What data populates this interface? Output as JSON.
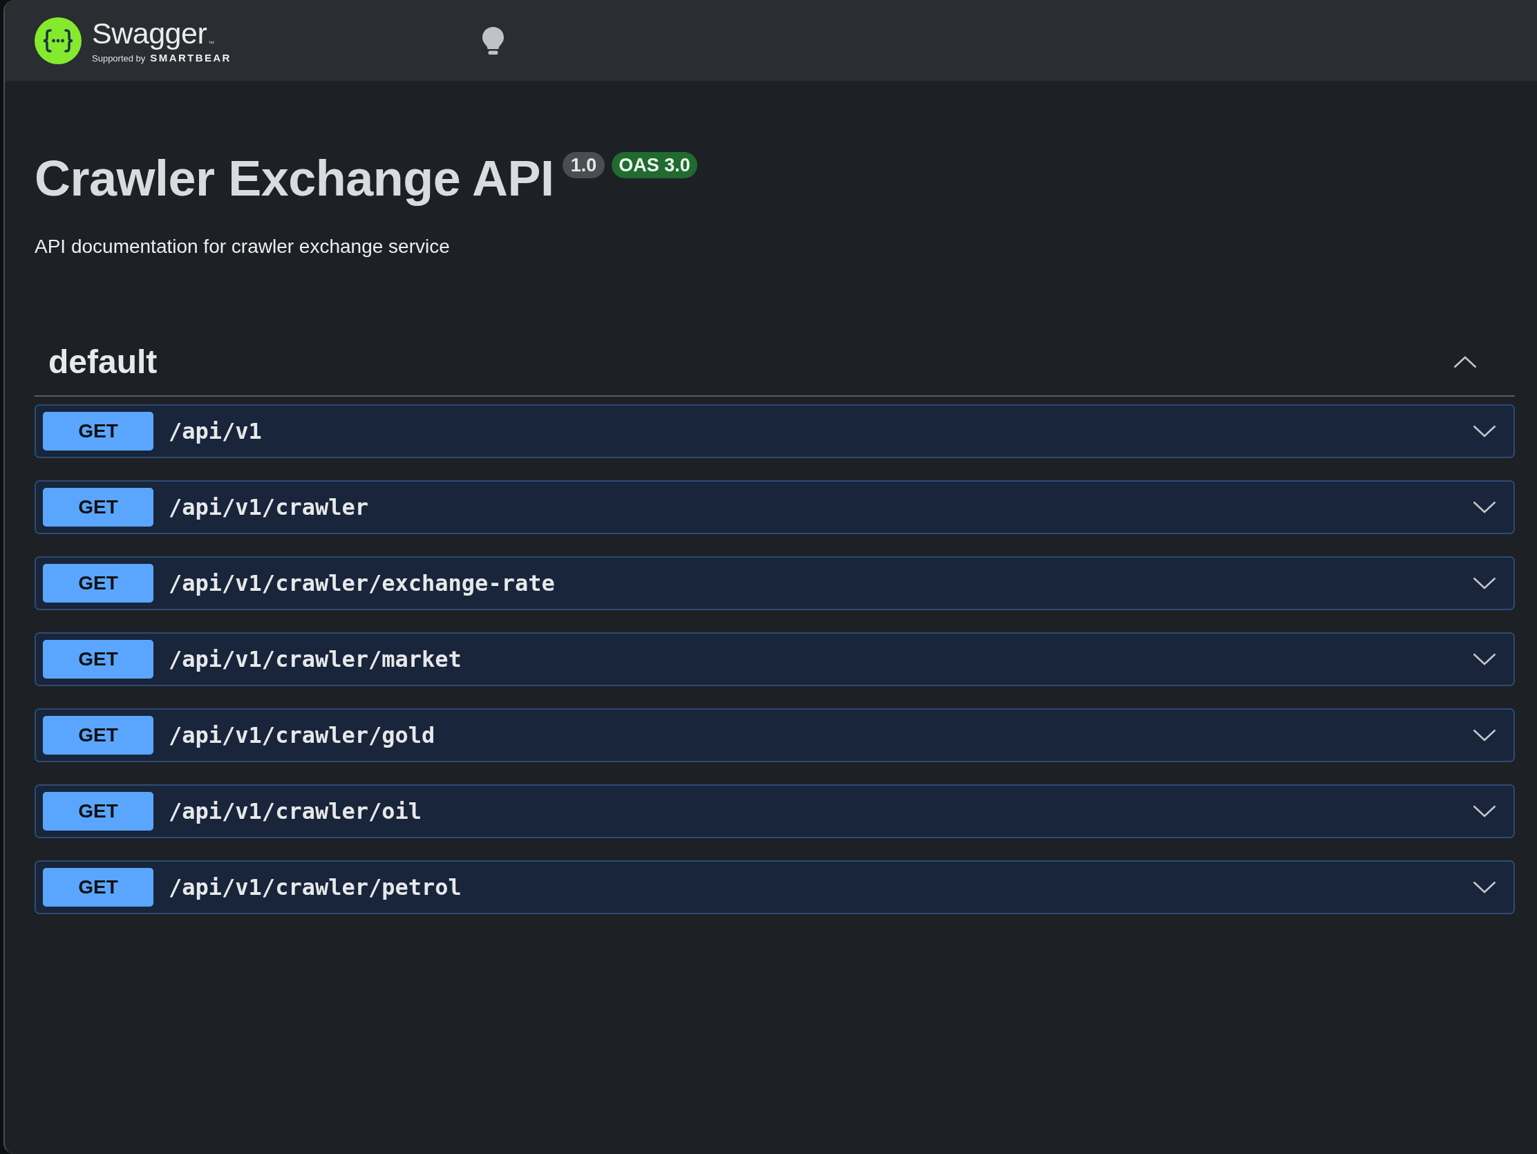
{
  "header": {
    "logo": {
      "wordmark": "Swagger",
      "trademark": "™",
      "tagline": "Supported by",
      "company": "SMARTBEAR"
    }
  },
  "info": {
    "title": "Crawler Exchange API",
    "version_badge": "1.0",
    "spec_badge": "OAS 3.0",
    "description": "API documentation for crawler exchange service"
  },
  "tag": {
    "name": "default",
    "expanded": true,
    "operations": [
      {
        "method": "GET",
        "path": "/api/v1",
        "expanded": false
      },
      {
        "method": "GET",
        "path": "/api/v1/crawler",
        "expanded": false
      },
      {
        "method": "GET",
        "path": "/api/v1/crawler/exchange-rate",
        "expanded": false
      },
      {
        "method": "GET",
        "path": "/api/v1/crawler/market",
        "expanded": false
      },
      {
        "method": "GET",
        "path": "/api/v1/crawler/gold",
        "expanded": false
      },
      {
        "method": "GET",
        "path": "/api/v1/crawler/oil",
        "expanded": false
      },
      {
        "method": "GET",
        "path": "/api/v1/crawler/petrol",
        "expanded": false
      }
    ]
  }
}
